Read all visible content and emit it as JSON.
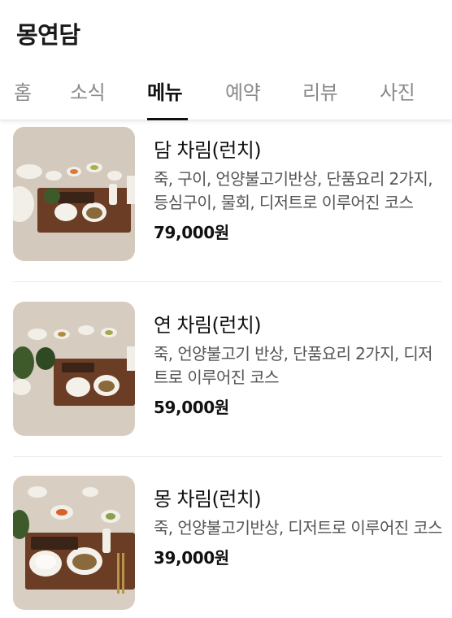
{
  "header": {
    "title": "몽연담"
  },
  "tabs": [
    {
      "label": "홈"
    },
    {
      "label": "소식"
    },
    {
      "label": "메뉴"
    },
    {
      "label": "예약"
    },
    {
      "label": "리뷰"
    },
    {
      "label": "사진"
    }
  ],
  "menu": {
    "items": [
      {
        "name": "담 차림(런치)",
        "description": "죽, 구이, 언양불고기반상, 단품요리 2가지, 등심구이, 물회, 디저트로 이루어진 코스",
        "price": "79,000원",
        "thumb_icon": "food-photo-icon"
      },
      {
        "name": "연 차림(런치)",
        "description": "죽, 언양불고기 반상, 단품요리 2가지, 디저트로 이루어진 코스",
        "price": "59,000원",
        "thumb_icon": "food-photo-icon"
      },
      {
        "name": "몽 차림(런치)",
        "description": "죽, 언양불고기반상, 디저트로 이루어진 코스",
        "price": "39,000원",
        "thumb_icon": "food-photo-icon"
      }
    ]
  },
  "colors": {
    "active_tab": "#111111",
    "inactive_tab": "#8a8a8a",
    "description": "#555555"
  }
}
